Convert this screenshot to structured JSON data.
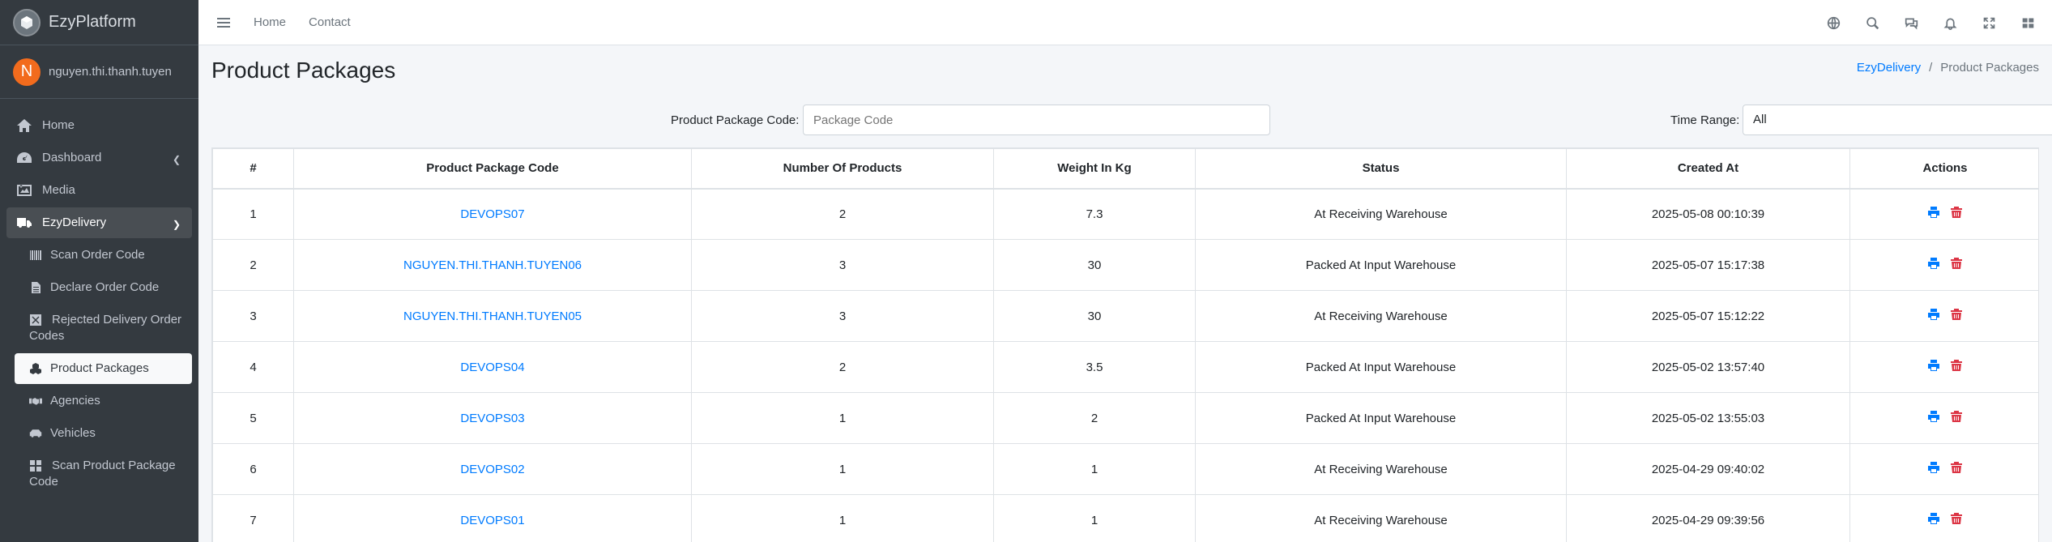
{
  "brand": {
    "name": "EzyPlatform"
  },
  "user": {
    "initial": "N",
    "name": "nguyen.thi.thanh.tuyen"
  },
  "sidebar": {
    "items": [
      {
        "label": "Home",
        "icon": "home-icon"
      },
      {
        "label": "Dashboard",
        "icon": "dashboard-icon"
      },
      {
        "label": "Media",
        "icon": "image-icon"
      },
      {
        "label": "EzyDelivery",
        "icon": "truck-icon"
      }
    ],
    "sub_items": [
      {
        "label": "Scan Order Code",
        "icon": "barcode-icon"
      },
      {
        "label": "Declare Order Code",
        "icon": "file-icon"
      },
      {
        "label": "Rejected Delivery Order Codes",
        "icon": "x-square-icon"
      },
      {
        "label": "Product Packages",
        "icon": "cubes-icon"
      },
      {
        "label": "Agencies",
        "icon": "handshake-icon"
      },
      {
        "label": "Vehicles",
        "icon": "vehicles-icon"
      },
      {
        "label": "Scan Product Package Code",
        "icon": "grid-icon"
      }
    ]
  },
  "topbar": {
    "home": "Home",
    "contact": "Contact"
  },
  "page": {
    "title": "Product Packages"
  },
  "breadcrumb": {
    "parent": "EzyDelivery",
    "separator": "/",
    "current": "Product Packages"
  },
  "filters": {
    "code_label": "Product Package Code:",
    "code_placeholder": "Package Code",
    "time_label": "Time Range:",
    "time_value": "All"
  },
  "table": {
    "headers": [
      "#",
      "Product Package Code",
      "Number Of Products",
      "Weight In Kg",
      "Status",
      "Created At",
      "Actions"
    ],
    "rows": [
      {
        "num": "1",
        "code": "DEVOPS07",
        "products": "2",
        "weight": "7.3",
        "status": "At Receiving Warehouse",
        "created": "2025-05-08 00:10:39"
      },
      {
        "num": "2",
        "code": "NGUYEN.THI.THANH.TUYEN06",
        "products": "3",
        "weight": "30",
        "status": "Packed At Input Warehouse",
        "created": "2025-05-07 15:17:38"
      },
      {
        "num": "3",
        "code": "NGUYEN.THI.THANH.TUYEN05",
        "products": "3",
        "weight": "30",
        "status": "At Receiving Warehouse",
        "created": "2025-05-07 15:12:22"
      },
      {
        "num": "4",
        "code": "DEVOPS04",
        "products": "2",
        "weight": "3.5",
        "status": "Packed At Input Warehouse",
        "created": "2025-05-02 13:57:40"
      },
      {
        "num": "5",
        "code": "DEVOPS03",
        "products": "1",
        "weight": "2",
        "status": "Packed At Input Warehouse",
        "created": "2025-05-02 13:55:03"
      },
      {
        "num": "6",
        "code": "DEVOPS02",
        "products": "1",
        "weight": "1",
        "status": "At Receiving Warehouse",
        "created": "2025-04-29 09:40:02"
      },
      {
        "num": "7",
        "code": "DEVOPS01",
        "products": "1",
        "weight": "1",
        "status": "At Receiving Warehouse",
        "created": "2025-04-29 09:39:56"
      }
    ]
  },
  "colors": {
    "sidebar": "#343a40",
    "link": "#007bff",
    "delete": "#dc3545",
    "avatar": "#f26b1d"
  }
}
